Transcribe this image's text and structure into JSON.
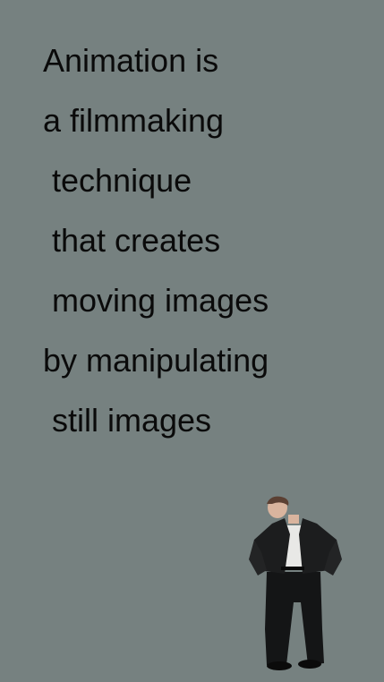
{
  "text_lines": [
    "Animation is",
    "a filmmaking",
    " technique",
    " that creates",
    " moving images",
    "by manipulating",
    " still images"
  ],
  "figure": {
    "icon": "standing-person-icon",
    "colors": {
      "background": "#768180",
      "text": "#0a0a0a",
      "jacket": "#1c1d1e",
      "shirt": "#e8e8e6",
      "skin": "#d9b49e",
      "hair": "#5b4033"
    }
  }
}
